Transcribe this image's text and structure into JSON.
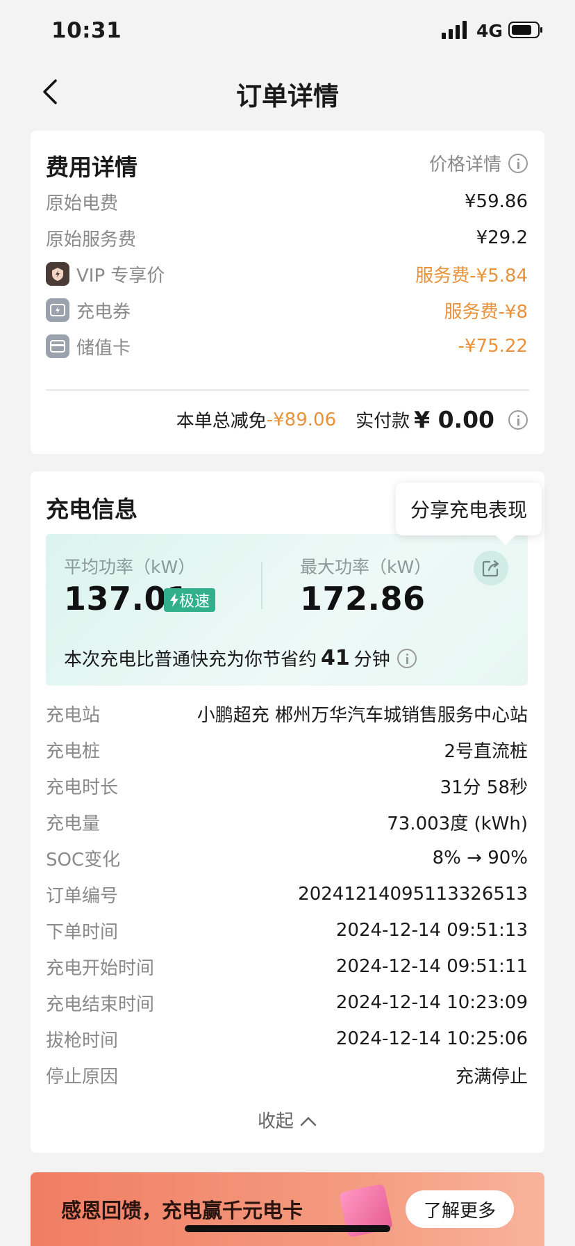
{
  "status_bar": {
    "time": "10:31",
    "network": "4G"
  },
  "nav": {
    "title": "订单详情"
  },
  "fee": {
    "title": "费用详情",
    "price_detail": "价格详情",
    "rows": [
      {
        "label": "原始电费",
        "value": "¥59.86"
      },
      {
        "label": "原始服务费",
        "value": "¥29.2"
      },
      {
        "label": "VIP 专享价",
        "value": "服务费-¥5.84"
      },
      {
        "label": "充电券",
        "value": "服务费-¥8"
      },
      {
        "label": "储值卡",
        "value": "-¥75.22"
      }
    ],
    "total_discount_label": "本单总减免",
    "total_discount_value": "-¥89.06",
    "paid_label": "实付款",
    "paid_value": "¥ 0.00"
  },
  "charge": {
    "title": "充电信息",
    "share_tooltip": "分享充电表现",
    "avg_power_label": "平均功率（kW）",
    "avg_power_value": "137.01",
    "fast_badge": "极速",
    "max_power_label": "最大功率（kW）",
    "max_power_value": "172.86",
    "save_prefix": "本次充电比普通快充为你节省约",
    "save_minutes": "41",
    "save_suffix": "分钟",
    "rows": [
      {
        "label": "充电站",
        "value": "小鹏超充 郴州万华汽车城销售服务中心站"
      },
      {
        "label": "充电桩",
        "value": "2号直流桩"
      },
      {
        "label": "充电时长",
        "value": "31分 58秒"
      },
      {
        "label": "充电量",
        "value": "73.003度 (kWh)"
      },
      {
        "label": "SOC变化",
        "value": "8% → 90%"
      },
      {
        "label": "订单编号",
        "value": "20241214095113326513"
      },
      {
        "label": "下单时间",
        "value": "2024-12-14 09:51:13"
      },
      {
        "label": "充电开始时间",
        "value": "2024-12-14 09:51:11"
      },
      {
        "label": "充电结束时间",
        "value": "2024-12-14 10:23:09"
      },
      {
        "label": "拔枪时间",
        "value": "2024-12-14 10:25:06"
      },
      {
        "label": "停止原因",
        "value": "充满停止"
      }
    ],
    "collapse_label": "收起"
  },
  "banner": {
    "text": "感恩回馈，充电赢千元电卡",
    "button": "了解更多"
  },
  "colors": {
    "accent_orange": "#e9923b",
    "fast_green": "#32b08e"
  }
}
